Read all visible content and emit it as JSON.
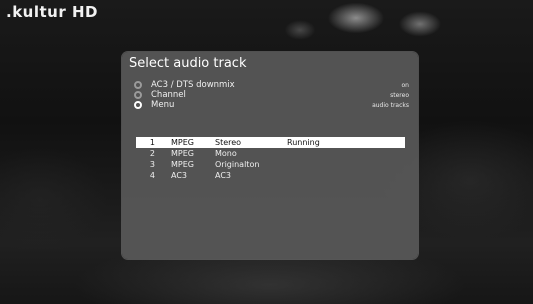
{
  "channel": {
    "logo_text": ".kultur HD"
  },
  "dialog": {
    "title": "Select audio track",
    "options": [
      {
        "label": "AC3 / DTS downmix",
        "value": "on",
        "selected": false
      },
      {
        "label": "Channel",
        "value": "stereo",
        "selected": false
      },
      {
        "label": "Menu",
        "value": "audio tracks",
        "selected": true
      }
    ],
    "tracks": [
      {
        "num": "1",
        "codec": "MPEG",
        "type": "Stereo",
        "status": "Running",
        "selected": true
      },
      {
        "num": "2",
        "codec": "MPEG",
        "type": "Mono",
        "status": "",
        "selected": false
      },
      {
        "num": "3",
        "codec": "MPEG",
        "type": "Originalton",
        "status": "",
        "selected": false
      },
      {
        "num": "4",
        "codec": "AC3",
        "type": "AC3",
        "status": "",
        "selected": false
      }
    ]
  },
  "colors": {
    "selection": "#ffffff",
    "dialog_bg": "#585858"
  }
}
